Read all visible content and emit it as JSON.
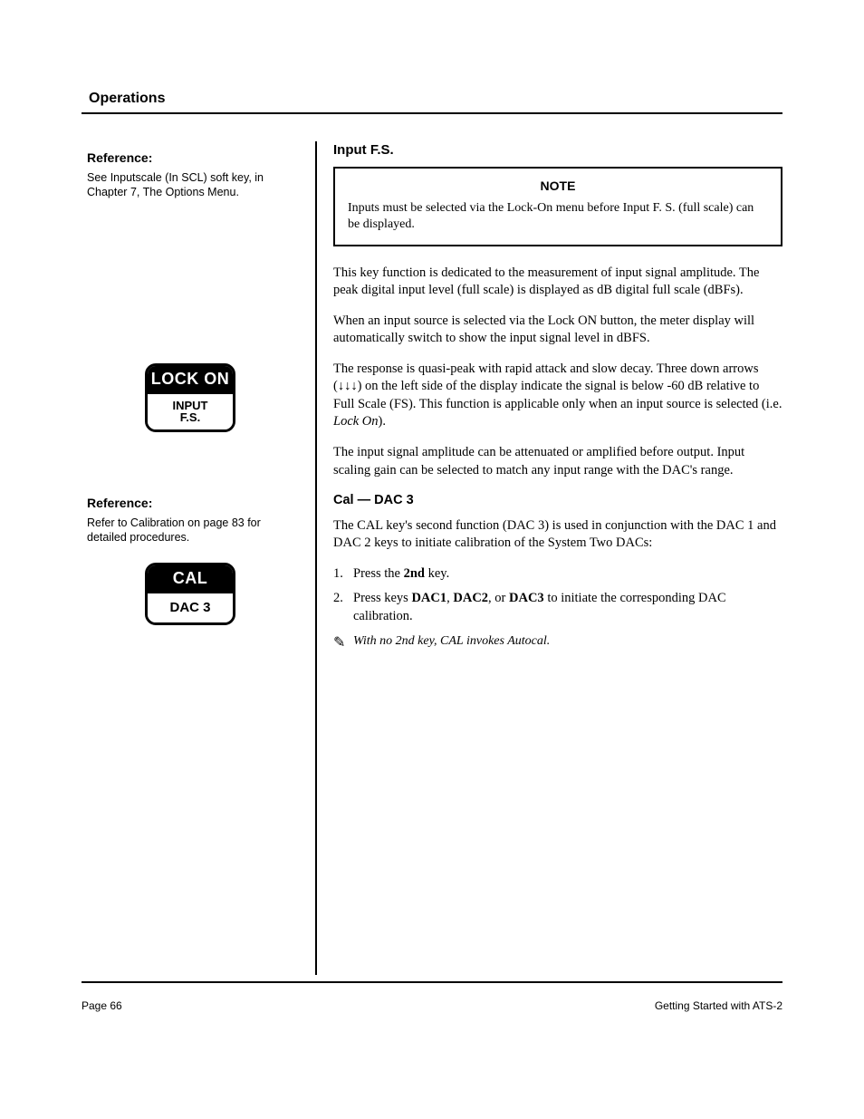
{
  "page_title": "Operations",
  "left": {
    "ref1_heading": "Reference:",
    "ref1_text": "See Inputscale (In SCL) soft key, in Chapter 7, The Options Menu.",
    "badge1_top": "LOCK ON",
    "badge1_bot_line1": "INPUT",
    "badge1_bot_line2": "F.S.",
    "ref2_heading": "Reference:",
    "ref2_text": "Refer to Calibration on page 83 for detailed procedures.",
    "badge2_top": "CAL",
    "badge2_bot": "DAC 3"
  },
  "right": {
    "heading_inputfs": "Input F.S.",
    "note_label": "NOTE",
    "note_body": "Inputs must be selected via the Lock-On menu before Input F. S. (full scale) can be displayed.",
    "p1": "This key function is dedicated to the measurement of input signal amplitude. The peak digital input level (full scale) is displayed as dB digital full scale (dBFs).",
    "p2": "When an input source is selected via the Lock ON button, the meter display will automatically switch to show the input signal level in dBFS.",
    "p3": "The response is quasi-peak with rapid attack and slow decay. Three down arrows (↓↓↓) on the left side of the display indicate the signal is below -60 dB relative to Full Scale (FS). This function is applicable only when an input source is selected (i.e. ",
    "p3_ital": "Lock On",
    "p3_tail": ").",
    "p4": "The input signal amplitude can be attenuated or amplified before output. Input scaling gain can be selected to match any input range with the DAC's range.",
    "heading_cal": "Cal — DAC 3",
    "cal_p1": "The CAL key's second function (DAC 3) is used in conjunction with the DAC 1 and DAC 2 keys to initiate calibration of the System Two DACs:",
    "step1_num": "1.",
    "step1_txt_prefix": "Press the ",
    "step1_txt_key": "2nd",
    "step1_txt_suffix": " key.",
    "step2_num": "2.",
    "step2_txt_prefix": "Press keys ",
    "step2_txt_k1": "DAC1",
    "step2_txt_m1": ", ",
    "step2_txt_k2": "DAC2",
    "step2_txt_m2": ", or ",
    "step2_txt_k3": "DAC3",
    "step2_txt_suffix": " to initiate the corresponding DAC calibration.",
    "pencil_note": "With no 2nd key, CAL invokes Autocal."
  },
  "footer": {
    "left": "Page 66",
    "right": "Getting Started with ATS-2"
  }
}
